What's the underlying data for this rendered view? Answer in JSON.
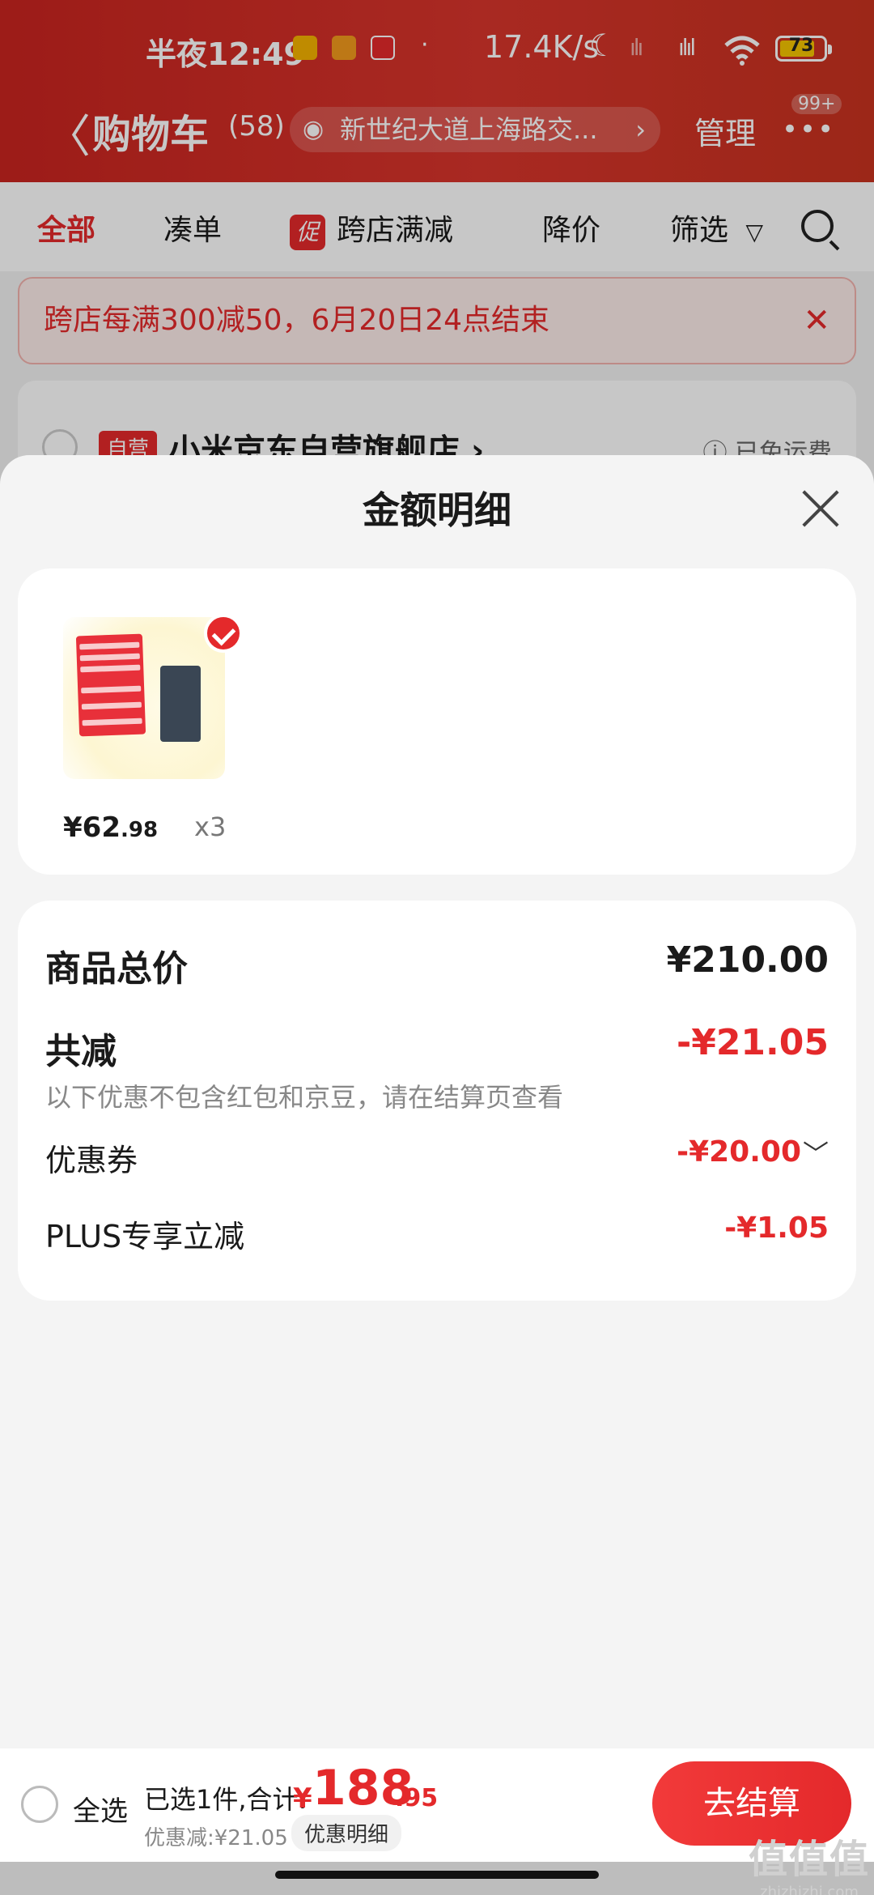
{
  "status_bar": {
    "time": "半夜12:49",
    "dot": "·",
    "net_speed": "17.4K/s",
    "moon_icon": "☾",
    "signal1": "ılı",
    "signal2": "ılıl",
    "wifi_icon": "📶",
    "battery": "73"
  },
  "nav": {
    "back": "〈",
    "title": "购物车",
    "count": "(58)",
    "address": "新世纪大道上海路交...",
    "eye_icon": "◉",
    "chevron": "›",
    "manage": "管理",
    "more": "•••",
    "badge": "99+"
  },
  "tabs": {
    "all": "全部",
    "combine": "凑单",
    "promo_badge": "促",
    "cross_store": "跨店满减",
    "price_drop": "降价",
    "filter": "筛选",
    "filter_icon": "▽"
  },
  "promo_banner": {
    "text": "跨店每满300减50，6月20日24点结束",
    "close": "✕"
  },
  "store": {
    "tag": "自营",
    "name": "小米京东自营旗舰店 ›",
    "shipping": "ⓘ 已免运费"
  },
  "sheet": {
    "title": "金额明细",
    "product": {
      "price_main": "¥62",
      "price_decimal": ".98",
      "quantity": "x3"
    },
    "summary": {
      "total_label": "商品总价",
      "total_value": "¥210.00",
      "reduce_label": "共减",
      "reduce_value": "-¥21.05",
      "note": "以下优惠不包含红包和京豆，请在结算页查看",
      "coupon_label": "优惠券",
      "coupon_value": "-¥20.00",
      "coupon_chevron": "﹀",
      "plus_label": "PLUS专享立减",
      "plus_value": "-¥1.05"
    }
  },
  "bottom_bar": {
    "select_all": "全选",
    "selected_text": "已选1件,合计:",
    "currency": "¥",
    "amount_main": "188",
    "amount_decimal": ".95",
    "discount_text": "优惠减:¥21.05",
    "detail_button": "优惠明细",
    "checkout_button": "去结算"
  },
  "watermark": {
    "text": "值值值",
    "site": "zhizhizhi.com"
  },
  "colors": {
    "accent": "#e4292b",
    "header_red": "#d9352c"
  }
}
